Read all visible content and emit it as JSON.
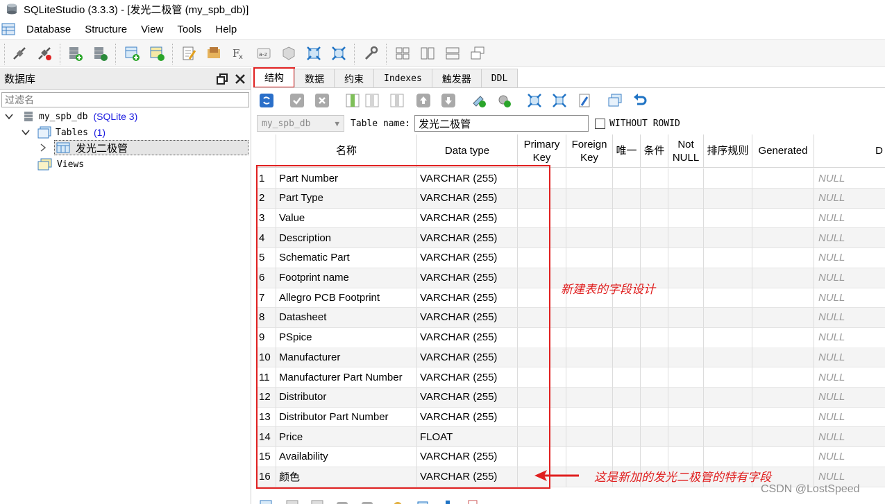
{
  "window": {
    "title": "SQLiteStudio (3.3.3) - [发光二极管 (my_spb_db)]"
  },
  "menu": [
    "Database",
    "Structure",
    "View",
    "Tools",
    "Help"
  ],
  "left_panel": {
    "header": "数据库",
    "filter_placeholder": "过滤名",
    "db_name": "my_spb_db",
    "db_type": "(SQLite 3)",
    "tables_label": "Tables",
    "tables_count": "(1)",
    "table_item": "发光二极管",
    "views_label": "Views"
  },
  "tabs": [
    "结构",
    "数据",
    "约束",
    "Indexes",
    "触发器",
    "DDL"
  ],
  "name_row": {
    "db_combo": "my_spb_db",
    "table_name_label": "Table name:",
    "table_name_value": "发光二极管",
    "without_rowid_label": "WITHOUT ROWID",
    "without_rowid_checked": false
  },
  "grid": {
    "headers": [
      "名称",
      "Data type",
      "Primary\nKey",
      "Foreign\nKey",
      "唯一",
      "条件",
      "Not\nNULL",
      "排序规则",
      "Generated",
      "D"
    ],
    "null_text": "NULL",
    "rows": [
      {
        "n": "1",
        "name": "Part Number",
        "type": "VARCHAR (255)"
      },
      {
        "n": "2",
        "name": "Part Type",
        "type": "VARCHAR (255)"
      },
      {
        "n": "3",
        "name": "Value",
        "type": "VARCHAR (255)"
      },
      {
        "n": "4",
        "name": "Description",
        "type": "VARCHAR (255)"
      },
      {
        "n": "5",
        "name": "Schematic Part",
        "type": "VARCHAR (255)"
      },
      {
        "n": "6",
        "name": "Footprint name",
        "type": "VARCHAR (255)"
      },
      {
        "n": "7",
        "name": "Allegro PCB Footprint",
        "type": "VARCHAR (255)"
      },
      {
        "n": "8",
        "name": "Datasheet",
        "type": "VARCHAR (255)"
      },
      {
        "n": "9",
        "name": "PSpice",
        "type": "VARCHAR (255)"
      },
      {
        "n": "10",
        "name": "Manufacturer",
        "type": "VARCHAR (255)"
      },
      {
        "n": "11",
        "name": "Manufacturer Part Number",
        "type": "VARCHAR (255)"
      },
      {
        "n": "12",
        "name": "Distributor",
        "type": "VARCHAR (255)"
      },
      {
        "n": "13",
        "name": "Distributor Part Number",
        "type": "VARCHAR (255)"
      },
      {
        "n": "14",
        "name": "Price",
        "type": "FLOAT"
      },
      {
        "n": "15",
        "name": "Availability",
        "type": "VARCHAR (255)"
      },
      {
        "n": "16",
        "name": "颜色",
        "type": "VARCHAR (255)"
      }
    ]
  },
  "annotations": {
    "fields_note": "新建表的字段设计",
    "new_field_note": "这是新加的发光二极管的特有字段"
  },
  "watermark": "CSDN @LostSpeed",
  "colors": {
    "annotation_red": "#e02020",
    "link_blue": "#1a1ae0",
    "null_gray": "#9a9a9a"
  }
}
